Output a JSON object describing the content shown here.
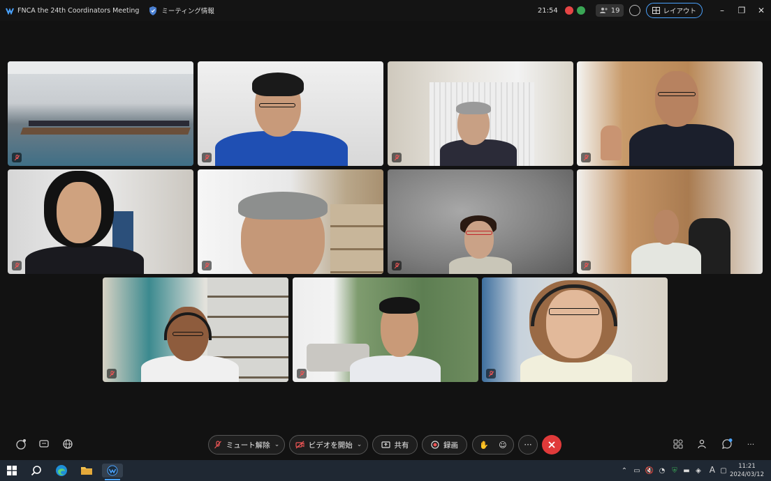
{
  "titlebar": {
    "app_title": "FNCA the 24th Coordinators Meeting",
    "meeting_info": "ミーティング情報",
    "clock": "21:54",
    "participants_count": "19",
    "layout_label": "レイアウト"
  },
  "colors": {
    "accent": "#4aa3ff",
    "end_call": "#e03a3a",
    "background": "#121212"
  },
  "video_tiles": [
    {
      "id": "conference-room",
      "muted": true
    },
    {
      "id": "participant-blue-shirt",
      "muted": true
    },
    {
      "id": "participant-office-elder",
      "muted": true
    },
    {
      "id": "participant-waving",
      "muted": true
    },
    {
      "id": "participant-woman-dark-hair",
      "muted": true
    },
    {
      "id": "participant-gray-hair",
      "muted": true
    },
    {
      "id": "participant-red-glasses",
      "muted": true
    },
    {
      "id": "participant-white-shirt",
      "muted": true
    },
    {
      "id": "participant-headset-man",
      "muted": true
    },
    {
      "id": "participant-suit-trees",
      "muted": true
    },
    {
      "id": "participant-headset-woman",
      "muted": true
    }
  ],
  "toolbar": {
    "unmute_label": "ミュート解除",
    "start_video_label": "ビデオを開始",
    "share_label": "共有",
    "record_label": "録画"
  },
  "taskbar": {
    "time": "11:21",
    "date": "2024/03/12",
    "ime": "A"
  }
}
